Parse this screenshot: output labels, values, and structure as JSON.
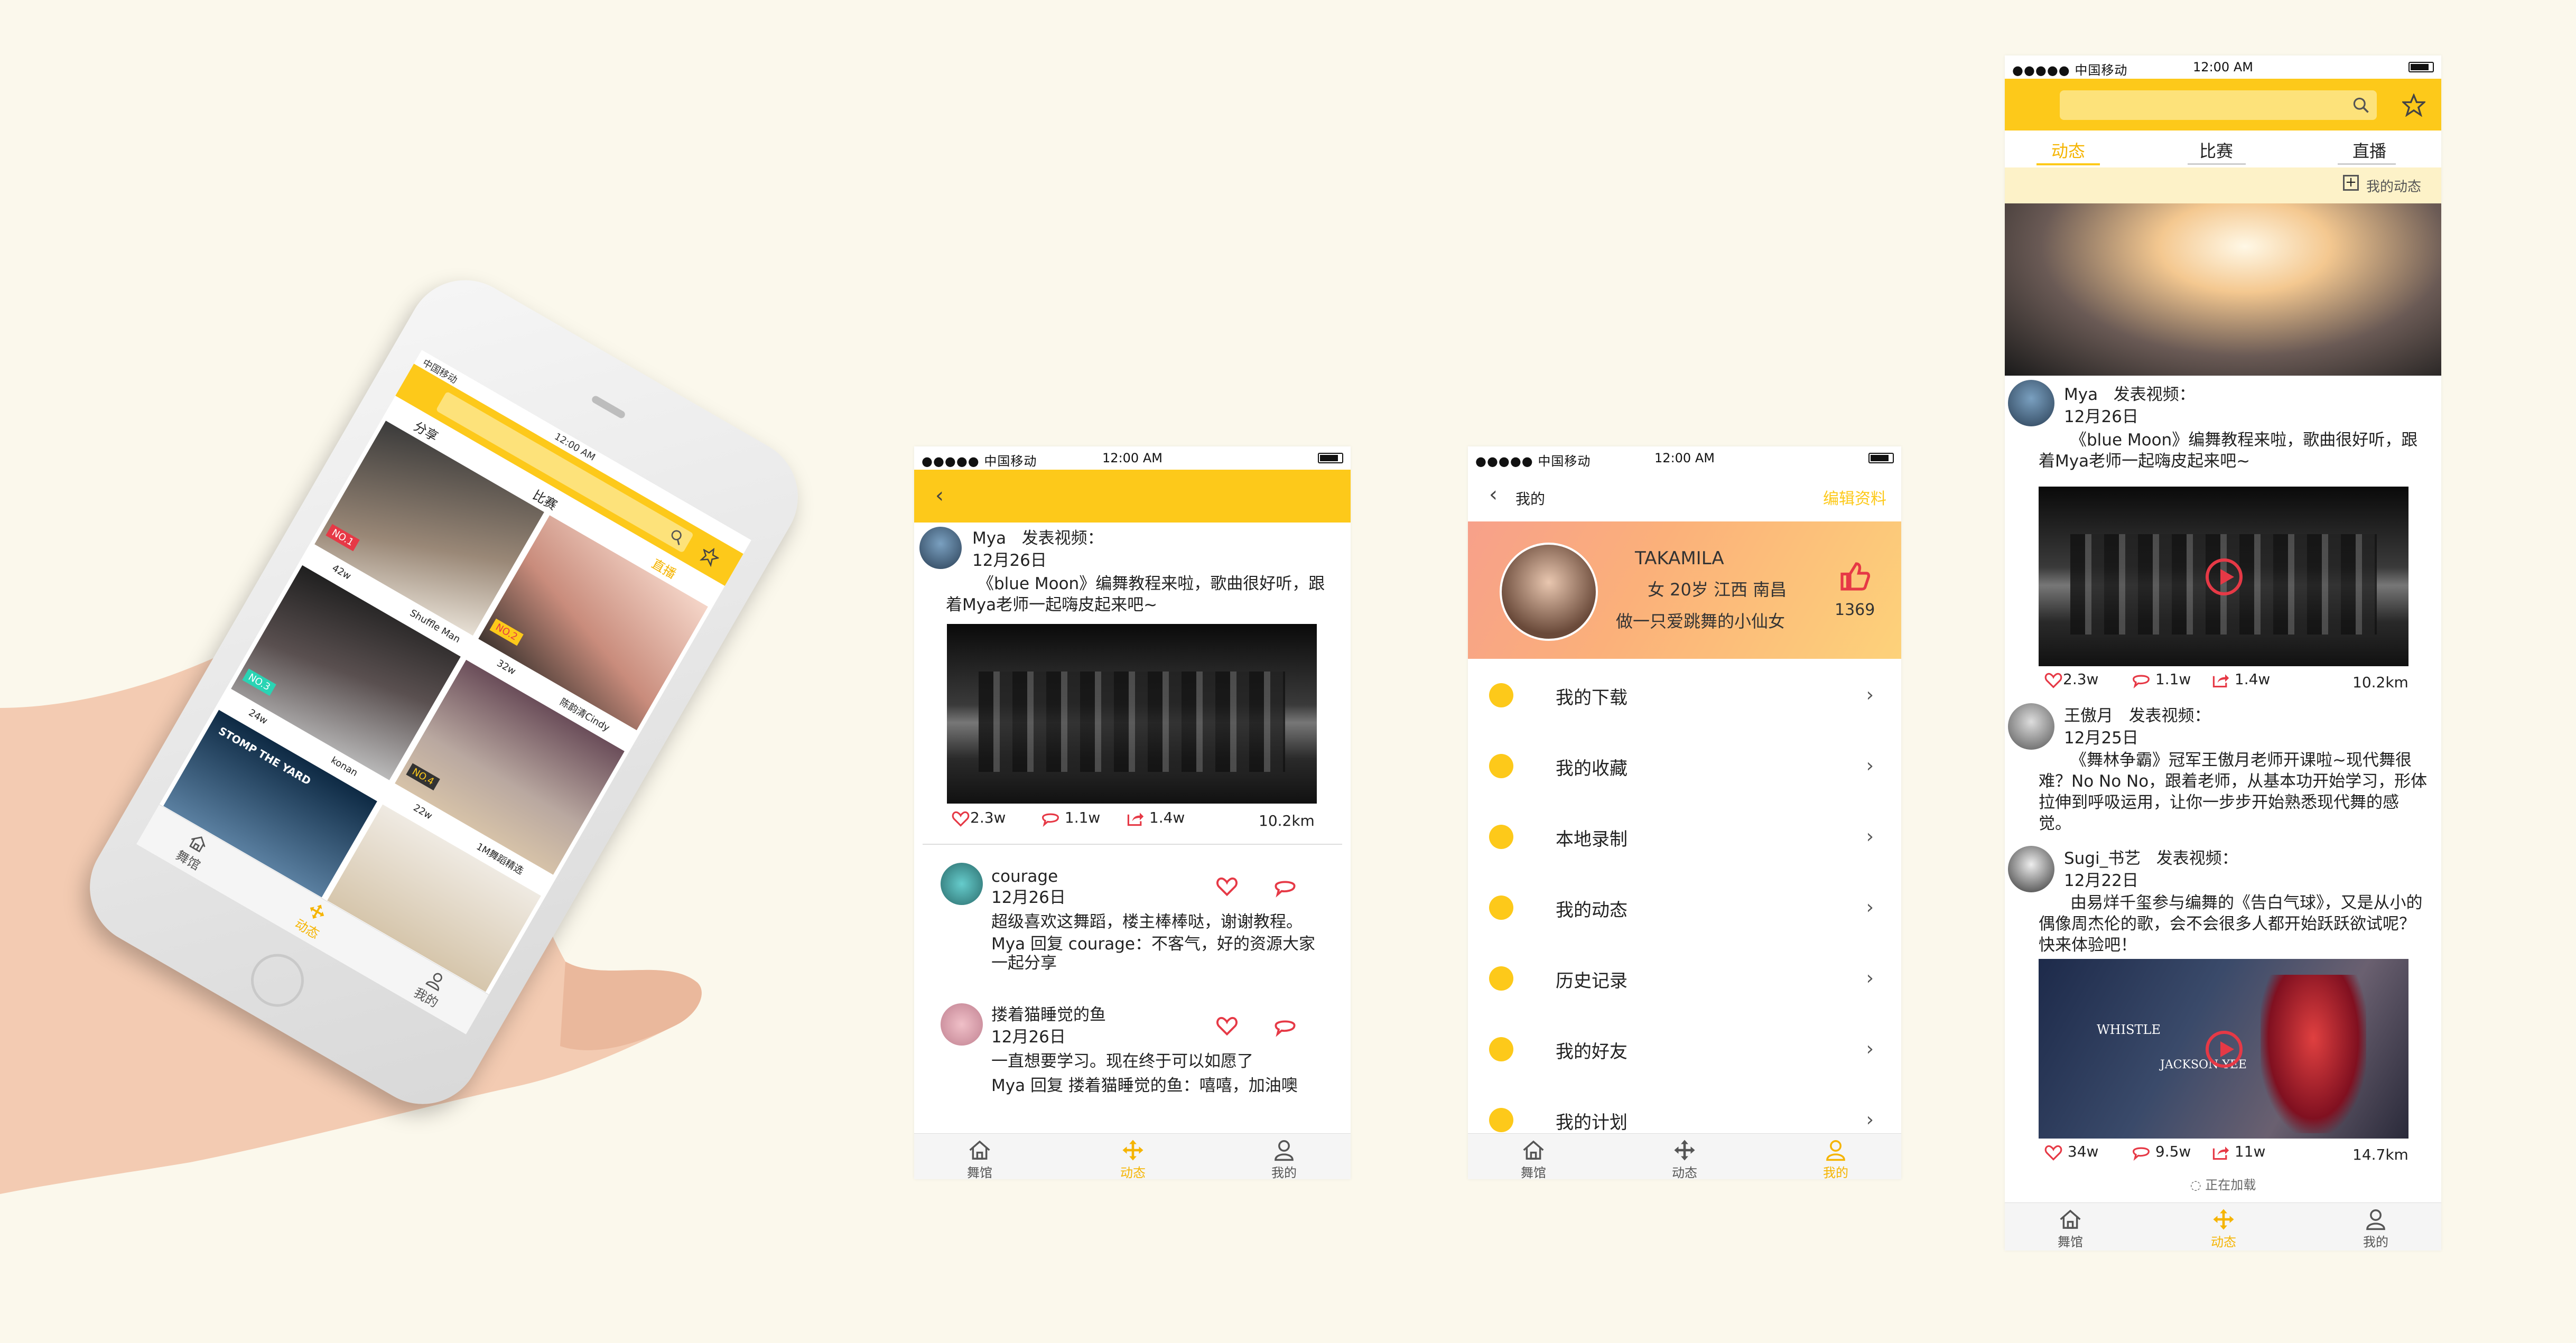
{
  "colors": {
    "accent": "#fdc91a",
    "background": "#fbf8ec",
    "like": "#e63946"
  },
  "status": {
    "carrier": "中国移动",
    "time": "12:00 AM",
    "dots": "●●●●●"
  },
  "tabs": {
    "home": "舞馆",
    "feed": "动态",
    "mine": "我的"
  },
  "phone": {
    "tabs": [
      "分享",
      "比赛",
      "直播"
    ],
    "cards": [
      {
        "badge": "NO.1",
        "count": "42w",
        "name": "Shuffle Man"
      },
      {
        "badge": "NO.2",
        "count": "32w",
        "name": "陈韵清Cindy"
      },
      {
        "badge": "NO.3",
        "count": "24w",
        "name": "konan"
      },
      {
        "badge": "NO.4",
        "count": "22w",
        "name": "1M舞蹈精选"
      }
    ],
    "video_text": "STOMP THE YARD"
  },
  "detail": {
    "post": {
      "user": "Mya",
      "action": "发表视频：",
      "date": "12月26日",
      "text": "《blue Moon》编舞教程来啦，歌曲很好听，跟着Mya老师一起嗨皮起来吧~"
    },
    "stats": {
      "likes": "2.3w",
      "comments": "1.1w",
      "shares": "1.4w",
      "distance": "10.2km"
    },
    "comments": [
      {
        "user": "courage",
        "date": "12月26日",
        "text": "超级喜欢这舞蹈，楼主棒棒哒，谢谢教程。",
        "reply": "Mya 回复 courage：不客气，好的资源大家一起分享"
      },
      {
        "user": "搂着猫睡觉的鱼",
        "date": "12月26日",
        "text": "一直想要学习。现在终于可以如愿了",
        "reply": "Mya 回复 搂着猫睡觉的鱼：嘻嘻，加油噢"
      }
    ]
  },
  "profile": {
    "back": "我的",
    "edit": "编辑资料",
    "name": "TAKAMILA",
    "info": "女 20岁 江西 南昌",
    "bio": "做一只爱跳舞的小仙女",
    "likes": "1369",
    "menu": [
      "我的下载",
      "我的收藏",
      "本地录制",
      "我的动态",
      "历史记录",
      "我的好友",
      "我的计划"
    ]
  },
  "feed": {
    "tabs": [
      "动态",
      "比赛",
      "直播"
    ],
    "my_feed": "我的动态",
    "posts": [
      {
        "user": "Mya",
        "action": "发表视频：",
        "date": "12月26日",
        "text": "《blue Moon》编舞教程来啦，歌曲很好听，跟着Mya老师一起嗨皮起来吧~",
        "stats": [
          "2.3w",
          "1.1w",
          "1.4w",
          "10.2km"
        ]
      },
      {
        "user": "王傲月",
        "action": "发表视频：",
        "date": "12月25日",
        "text": "《舞林争霸》冠军王傲月老师开课啦~现代舞很难？No No No，跟着老师，从基本功开始学习，形体拉伸到呼吸运用，让你一步步开始熟悉现代舞的感觉。"
      },
      {
        "user": "Sugi_书艺",
        "action": "发表视频：",
        "date": "12月22日",
        "text": "由易烊千玺参与编舞的《告白气球》，又是从小的偶像周杰伦的歌，会不会很多人都开始跃跃欲试呢？快来体验吧！",
        "stats": [
          "34w",
          "9.5w",
          "11w",
          "14.7km"
        ]
      }
    ],
    "video_caption1": "WHISTLE",
    "video_caption2": "JACKSON YEE",
    "loading": "正在加载"
  }
}
